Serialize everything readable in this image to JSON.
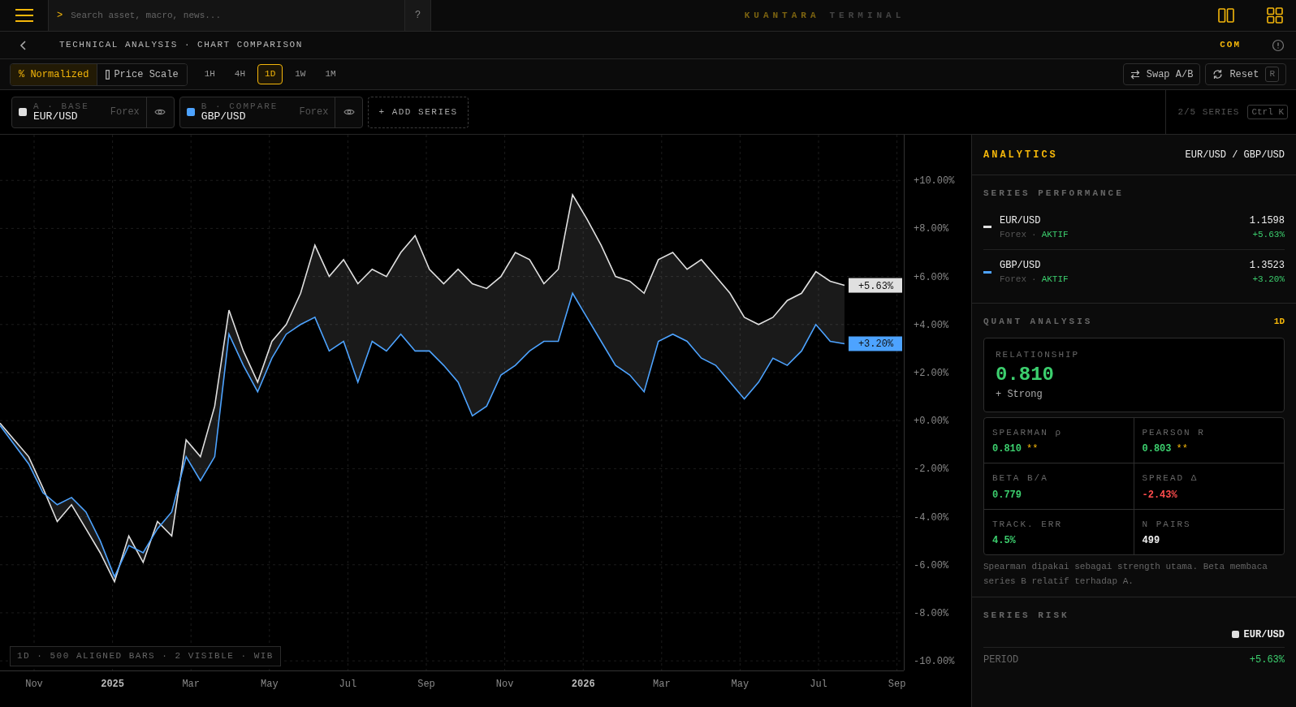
{
  "topbar": {
    "search": {
      "prompt": ">",
      "placeholder": "Search asset, macro, news..."
    },
    "help": "?",
    "brand": {
      "primary": "KUANTARA",
      "secondary": "TERMINAL"
    }
  },
  "breadcrumb": {
    "title": "TECHNICAL ANALYSIS · CHART COMPARISON",
    "mode": "COM"
  },
  "scale_modes": [
    {
      "kind": "percent",
      "label": "% Normalized",
      "selected": true
    },
    {
      "kind": "price",
      "label": "Price Scale",
      "selected": false
    }
  ],
  "timeframes": [
    {
      "label": "1H",
      "selected": false
    },
    {
      "label": "4H",
      "selected": false
    },
    {
      "label": "1D",
      "selected": true
    },
    {
      "label": "1W",
      "selected": false
    },
    {
      "label": "1M",
      "selected": false
    }
  ],
  "actions": [
    {
      "kind": "swap",
      "label": "Swap A/B"
    },
    {
      "kind": "reset",
      "label": "Reset",
      "shortcut": "R"
    }
  ],
  "series": [
    {
      "slot": "A · BASE",
      "market": "Forex",
      "color": "#e0e0e0"
    },
    {
      "slot": "B · COMPARE",
      "market": "Forex",
      "color": "#4da3ff"
    }
  ],
  "add_series": "+ ADD SERIES",
  "series_count": {
    "text": "2/5 SERIES",
    "shortcut": "Ctrl K"
  },
  "chart": {
    "badges": [
      {
        "text": "+5.63%",
        "color": "#e0e0e0"
      },
      {
        "text": "+3.20%",
        "color": "#4da3ff"
      }
    ],
    "footer": "1D · 500 ALIGNED BARS · 2 VISIBLE · WIB",
    "x_labels": [
      {
        "label": "Nov",
        "kind": "month"
      },
      {
        "label": "2025",
        "kind": "year"
      },
      {
        "label": "Mar",
        "kind": "month"
      },
      {
        "label": "May",
        "kind": "month"
      },
      {
        "label": "Jul",
        "kind": "month"
      },
      {
        "label": "Sep",
        "kind": "month"
      },
      {
        "label": "Nov",
        "kind": "month"
      },
      {
        "label": "2026",
        "kind": "year"
      },
      {
        "label": "Mar",
        "kind": "month"
      },
      {
        "label": "May",
        "kind": "month"
      },
      {
        "label": "Jul",
        "kind": "month"
      },
      {
        "label": "Sep",
        "kind": "month"
      }
    ],
    "chart_data": {
      "type": "line",
      "ylim": [
        -10.4,
        11.9
      ],
      "grid": true,
      "yticks": [
        {
          "value": 10,
          "label": "+10.00%"
        },
        {
          "value": 8,
          "label": "+8.00%"
        },
        {
          "value": 6,
          "label": "+6.00%"
        },
        {
          "value": 4,
          "label": "+4.00%"
        },
        {
          "value": 2,
          "label": "+2.00%"
        },
        {
          "value": 0,
          "label": "+0.00%"
        },
        {
          "value": -2,
          "label": "-2.00%"
        },
        {
          "value": -4,
          "label": "-4.00%"
        },
        {
          "value": -6,
          "label": "-6.00%"
        },
        {
          "value": -8,
          "label": "-8.00%"
        },
        {
          "value": -10,
          "label": "-10.00%"
        }
      ],
      "series": [
        {
          "name": "EUR/USD",
          "color": "#e0e0e0",
          "values": [
            -0.1,
            -0.8,
            -1.5,
            -2.8,
            -4.2,
            -3.5,
            -4.5,
            -5.5,
            -6.7,
            -4.8,
            -5.9,
            -4.2,
            -4.8,
            -0.8,
            -1.5,
            0.6,
            4.6,
            2.9,
            1.6,
            3.3,
            4.0,
            5.3,
            7.3,
            6.0,
            6.7,
            5.7,
            6.3,
            6.0,
            7.0,
            7.7,
            6.3,
            5.7,
            6.3,
            5.7,
            5.5,
            6.0,
            7.0,
            6.7,
            5.7,
            6.3,
            9.4,
            8.4,
            7.3,
            6.0,
            5.8,
            5.3,
            6.7,
            7.0,
            6.3,
            6.7,
            6.0,
            5.3,
            4.3,
            4.0,
            4.3,
            5.0,
            5.3,
            6.2,
            5.8,
            5.63
          ]
        },
        {
          "name": "GBP/USD",
          "color": "#4da3ff",
          "values": [
            -0.2,
            -1.0,
            -1.8,
            -3.0,
            -3.5,
            -3.2,
            -3.8,
            -5.0,
            -6.5,
            -5.2,
            -5.5,
            -4.5,
            -3.8,
            -1.5,
            -2.5,
            -1.5,
            3.6,
            2.3,
            1.2,
            2.6,
            3.6,
            4.0,
            4.3,
            2.9,
            3.3,
            1.6,
            3.3,
            2.9,
            3.6,
            2.9,
            2.9,
            2.3,
            1.6,
            0.2,
            0.6,
            1.9,
            2.3,
            2.9,
            3.3,
            3.3,
            5.3,
            4.3,
            3.3,
            2.3,
            1.9,
            1.2,
            3.3,
            3.6,
            3.3,
            2.6,
            2.3,
            1.6,
            0.9,
            1.6,
            2.6,
            2.3,
            2.9,
            4.0,
            3.3,
            3.2
          ]
        }
      ]
    }
  },
  "analytics": {
    "title": "ANALYTICS",
    "pair": "EUR/USD / GBP/USD",
    "performance": {
      "title": "SERIES PERFORMANCE",
      "rows": [
        {
          "symbol": "EUR/USD",
          "market": "Forex",
          "separator": "·",
          "status": "AKTIF",
          "price": "1.1598",
          "change": "+5.63%",
          "color": "#e0e0e0"
        },
        {
          "symbol": "GBP/USD",
          "market": "Forex",
          "separator": "·",
          "status": "AKTIF",
          "price": "1.3523",
          "change": "+3.20%",
          "color": "#4da3ff"
        }
      ]
    },
    "quant": {
      "title": "QUANT ANALYSIS",
      "timeframe": "1D",
      "relationship": {
        "label": "RELATIONSHIP",
        "value": "0.810",
        "strength": "+ Strong"
      },
      "metrics": [
        {
          "label": "SPEARMAN ρ",
          "value": "0.810",
          "significance": "**",
          "color": "#3ccf6e"
        },
        {
          "label": "PEARSON R",
          "value": "0.803",
          "significance": "**",
          "color": "#3ccf6e"
        },
        {
          "label": "BETA B/A",
          "value": "0.779",
          "color": "#3ccf6e"
        },
        {
          "label": "SPREAD Δ",
          "value": "-2.43%",
          "color": "#ff4d4d"
        },
        {
          "label": "TRACK. ERR",
          "value": "4.5%",
          "color": "#3ccf6e"
        },
        {
          "label": "N PAIRS",
          "value": "499",
          "color": "#eeeeee"
        }
      ],
      "note": "Spearman dipakai sebagai strength utama. Beta membaca series B relatif terhadap A."
    },
    "risk": {
      "title": "SERIES RISK",
      "series": {
        "symbol": "EUR/USD",
        "color": "#e0e0e0"
      },
      "rows": [
        {
          "label": "PERIOD",
          "value": "+5.63%"
        }
      ]
    }
  }
}
